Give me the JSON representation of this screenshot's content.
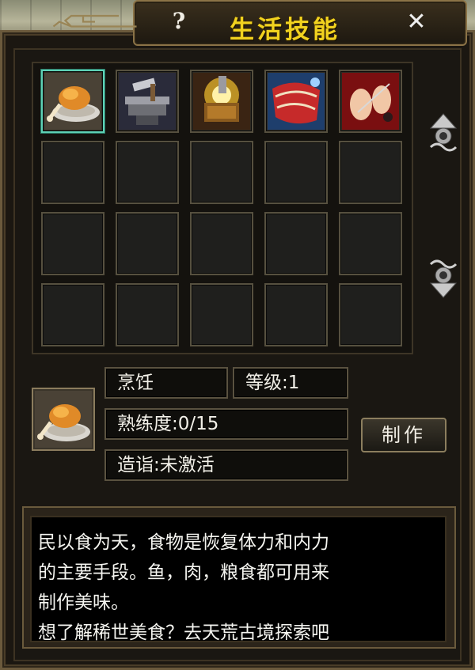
{
  "window": {
    "title": "生活技能",
    "help_label": "?",
    "close_label": "✕"
  },
  "skills": [
    {
      "name": "cooking",
      "icon": "roast-chicken-icon",
      "selected": true
    },
    {
      "name": "smithing",
      "icon": "anvil-hammer-icon",
      "selected": false
    },
    {
      "name": "forging",
      "icon": "forge-chest-icon",
      "selected": false
    },
    {
      "name": "tailoring",
      "icon": "cloth-bolt-icon",
      "selected": false
    },
    {
      "name": "needlework",
      "icon": "sewing-hands-icon",
      "selected": false
    }
  ],
  "grid": {
    "rows": 4,
    "cols": 5
  },
  "selected_skill": {
    "name": "烹饪",
    "level": "等级:1",
    "proficiency": "熟练度:0/15",
    "mastery": "造诣:未激活",
    "icon": "roast-chicken-icon"
  },
  "make_button": "制作",
  "description": {
    "lines": [
      "民以食为天，食物是恢复体力和内力",
      "的主要手段。鱼，肉，粮食都可用来",
      "制作美味。",
      "想了解稀世美食？去天荒古境探索吧"
    ]
  },
  "colors": {
    "title": "#f1d21f",
    "selection_border": "#5ed1b6",
    "frame": "#8b7347"
  }
}
